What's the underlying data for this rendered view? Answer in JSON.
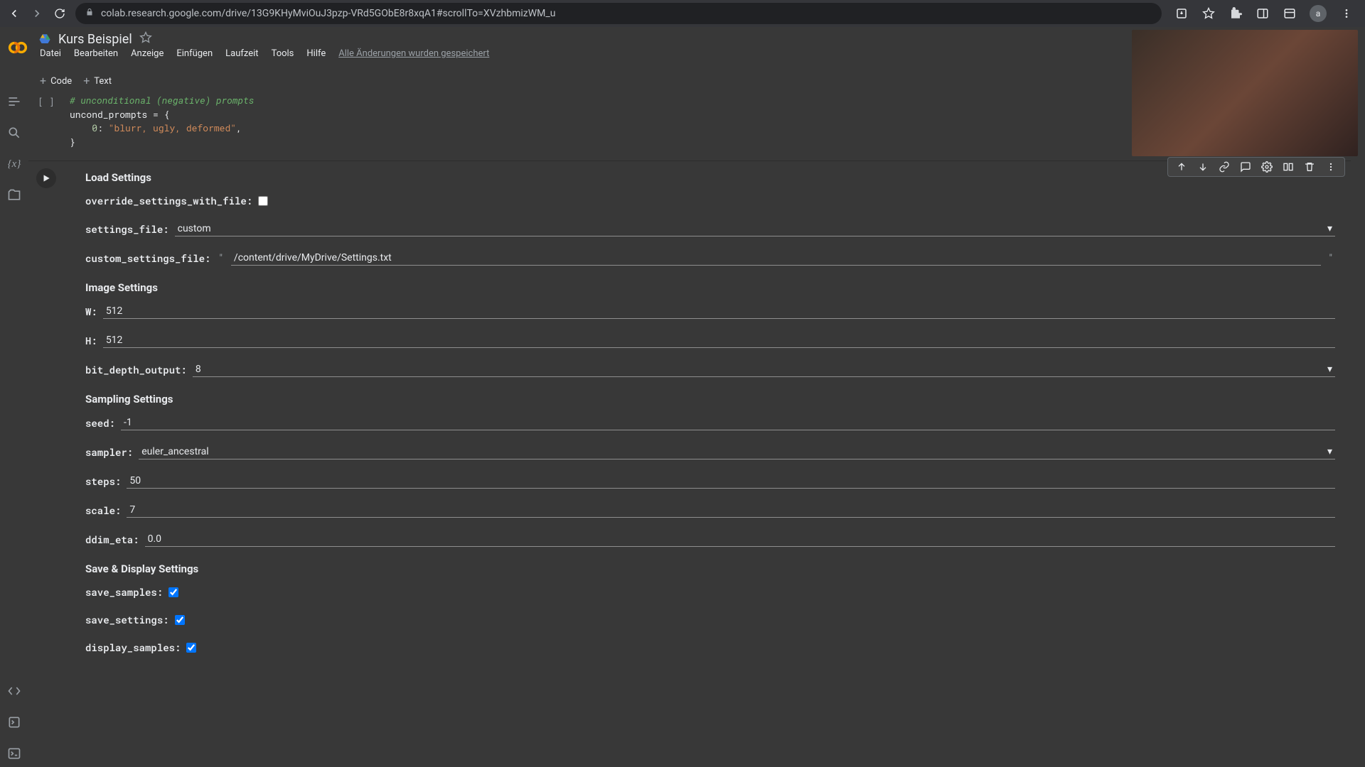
{
  "browser": {
    "url": "colab.research.google.com/drive/13G9KHyMviOuJ3pzp-VRd5GObE8r8xqA1#scrollTo=XVzhbmizWM_u"
  },
  "doc": {
    "title": "Kurs Beispiel"
  },
  "menu": {
    "items": [
      "Datei",
      "Bearbeiten",
      "Anzeige",
      "Einfügen",
      "Laufzeit",
      "Tools",
      "Hilfe"
    ],
    "saved": "Alle Änderungen wurden gespeichert"
  },
  "toolbar": {
    "code": "Code",
    "text": "Text"
  },
  "code_cell": {
    "label": "[ ]",
    "line0_comment": "# unconditional (negative) prompts",
    "line1": "uncond_prompts = {",
    "line2_key": "0",
    "line2_value": "\"blurr, ugly, deformed\"",
    "line3": "}"
  },
  "form": {
    "titles": {
      "load": "Load Settings",
      "image": "Image Settings",
      "sampling": "Sampling Settings",
      "save": "Save & Display Settings"
    },
    "load": {
      "override_label": "override_settings_with_file:",
      "override_checked": false,
      "settings_file_label": "settings_file:",
      "settings_file_value": "custom",
      "custom_file_label": "custom_settings_file:",
      "custom_file_value": "/content/drive/MyDrive/Settings.txt"
    },
    "image": {
      "w_label": "W:",
      "w_value": "512",
      "h_label": "H:",
      "h_value": "512",
      "bit_depth_label": "bit_depth_output:",
      "bit_depth_value": "8"
    },
    "sampling": {
      "seed_label": "seed:",
      "seed_value": "-1",
      "sampler_label": "sampler:",
      "sampler_value": "euler_ancestral",
      "steps_label": "steps:",
      "steps_value": "50",
      "scale_label": "scale:",
      "scale_value": "7",
      "ddim_eta_label": "ddim_eta:",
      "ddim_eta_value": "0.0"
    },
    "save": {
      "save_samples_label": "save_samples:",
      "save_samples_checked": true,
      "save_settings_label": "save_settings:",
      "save_settings_checked": true,
      "display_samples_label": "display_samples:",
      "display_samples_checked": true
    }
  }
}
